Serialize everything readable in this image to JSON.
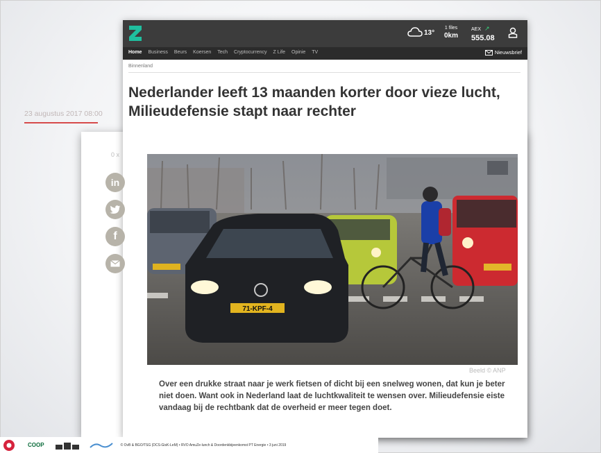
{
  "header": {
    "weather_temp": "13°",
    "files_label": "1 files",
    "files_value": "0km",
    "aex_label": "AEX",
    "aex_value": "555.08"
  },
  "nav": {
    "items": [
      "Home",
      "Business",
      "Beurs",
      "Koersen",
      "Tech",
      "Cryptocurrency",
      "Z Life",
      "Opinie",
      "TV"
    ],
    "newsletter": "Nieuwsbrief"
  },
  "breadcrumb": "Binnenland",
  "article": {
    "title": "Nederlander leeft 13 maanden korter door vieze lucht, Milieudefensie stapt naar rechter",
    "date": "23 augustus 2017 08:00",
    "share_count": "0 x",
    "image_credit": "Beeld © ANP",
    "license_plate": "71-KPF-4",
    "lead": "Over een drukke straat naar je werk fietsen of dicht bij een snelweg wonen, dat kun je beter niet doen. Want ook in Nederland laat de luchtkwaliteit te wensen over. Milieudefensie eiste vandaag bij de rechtbank dat de overheid er meer tegen doet."
  },
  "footer": {
    "logo_text": "COOP",
    "text": "© OvB & BGO/TSG (DCS-GisK-LeM) • RVO AmuZe-lunch & Doordenkbijeenkomst PT Energie • 3 juni 2019"
  },
  "colors": {
    "topbar": "#3c3c3c",
    "navbar": "#2b2b2b",
    "logo": "#1fbf9f",
    "accent_underline": "#d64a4a",
    "share_buttons": "#b7b3a9"
  },
  "icons": [
    "z-logo-icon",
    "cloud-icon",
    "arrow-up-right-icon",
    "user-icon",
    "mail-icon",
    "linkedin-icon",
    "twitter-icon",
    "facebook-icon",
    "email-share-icon"
  ]
}
